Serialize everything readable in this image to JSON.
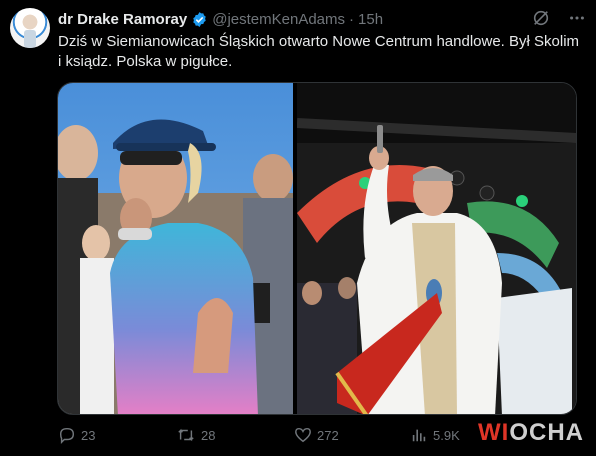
{
  "tweet": {
    "author_name": "dr Drake Ramoray",
    "handle": "@jestemKenAdams",
    "separator": "·",
    "time": "15h",
    "text": "Dziś w Siemianowicach Śląskich otwarto Nowe Centrum handlowe. Był Skolim i ksiądz. Polska w pigułce."
  },
  "media": [
    {
      "icon": "photo-singer-sunglasses-cap"
    },
    {
      "icon": "photo-priest-blessing-stage"
    }
  ],
  "actions": {
    "replies": "23",
    "reposts": "28",
    "likes": "272",
    "views": "5.9K"
  },
  "watermark": {
    "w": "W",
    "i": "I",
    "rest": "OCHA"
  },
  "colors": {
    "background": "#000000",
    "text": "#e7e9ea",
    "muted": "#71767b",
    "verified": "#1d9bf0",
    "border": "#2f3336",
    "watermark_red": "#e03527"
  }
}
